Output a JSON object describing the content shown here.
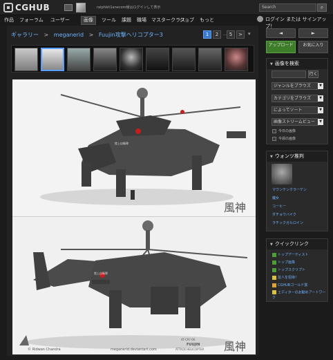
{
  "header": {
    "logo_text": "CGHUB",
    "notice": "ralphbit1anecom様はログインして表示",
    "search_placeholder": "Search",
    "search_icon": "magnifier-icon"
  },
  "nav": {
    "items": [
      "作品",
      "フォーラム",
      "ユーザー",
      "画像",
      "ツール",
      "課題",
      "職場",
      "マスタークラス",
      "ジョブ",
      "もっと"
    ],
    "active_index": 3,
    "login": "ログイン または サインアップ！"
  },
  "breadcrumb": [
    "ギャラリー",
    "meganerid",
    "Fuujin攻撃ヘリコプター3"
  ],
  "pagination": [
    "1",
    "2",
    "5",
    ">"
  ],
  "pagination_active": 0,
  "side": {
    "prev": "◄",
    "next": "►",
    "upload": "アップロード",
    "favorite": "お気に入り"
  },
  "search_panel": {
    "title": "画像を検索",
    "go": "行く",
    "dropdowns": [
      "ジャンルをブラウズ",
      "カテゴリをブラウズ",
      "によってソート",
      "画像ストリームビュー"
    ],
    "checkboxes": [
      "今日の画像",
      "今週の画像"
    ]
  },
  "artist_panel": {
    "title": "ウォンツ推判",
    "links": [
      "マウンテンクラーケン",
      "魔女",
      "コーヒー",
      "ダチョウバイク",
      "ラチックガルロイン"
    ]
  },
  "quick_panel": {
    "title": "クイックリンク",
    "links": [
      "トップアーティスト",
      "トップ画像",
      "トップスクリプト",
      "友人を招待！",
      "CGHUBゴールド賞",
      "エディターのお勧めアートワーク"
    ]
  },
  "image": {
    "watermark_top": "風神",
    "watermark_bottom": "風神",
    "model_code": "AT-C97-06",
    "model_name": "FUUJIN",
    "model_type": "ATTACK HELICOPTER",
    "credit_left": "© Ridwan Chandra",
    "credit_center": "meganerid.deviantart.com",
    "hull_text_top": "陸上自衛隊",
    "hull_text_bottom": "陸上自衛隊"
  },
  "colors": {
    "accent_blue": "#3a77d1",
    "link_blue": "#6fb3ff",
    "green_button": "#3d7d2a"
  }
}
